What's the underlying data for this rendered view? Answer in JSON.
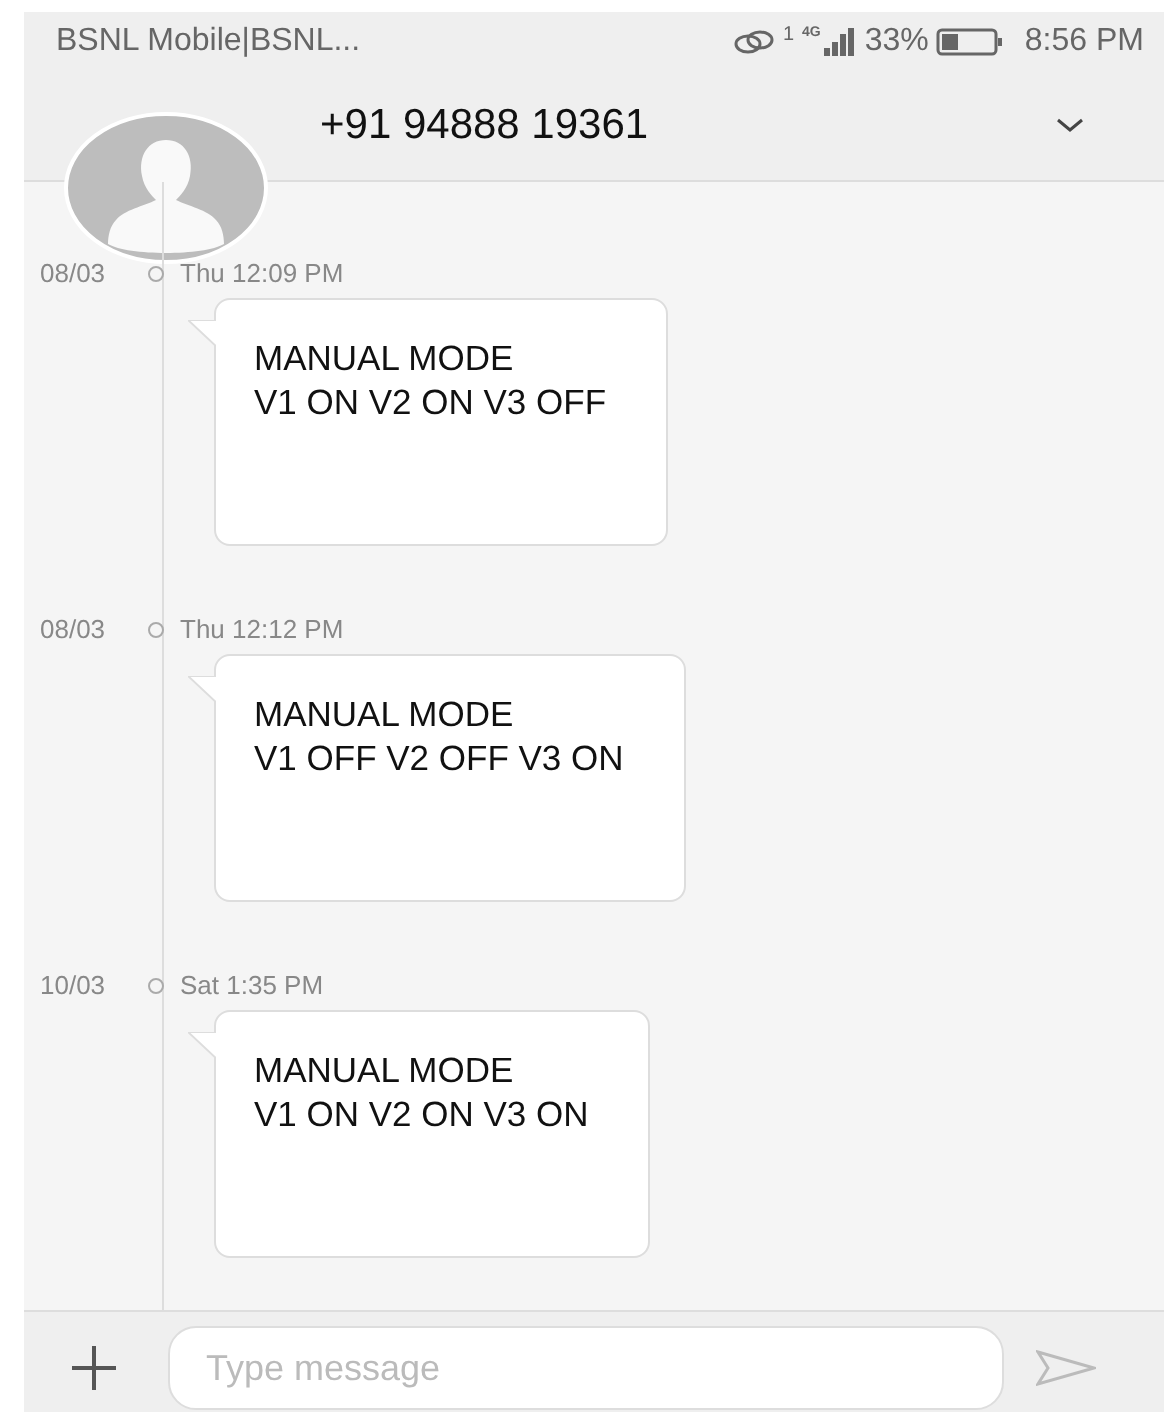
{
  "status_bar": {
    "carrier": "BSNL Mobile|BSNL...",
    "sim_label": "1",
    "network": "4G",
    "battery": "33%",
    "time": "8:56 PM"
  },
  "header": {
    "contact": "+91 94888 19361"
  },
  "messages": [
    {
      "date": "08/03",
      "time": "Thu 12:09 PM",
      "lines": [
        "MANUAL MODE",
        "V1 ON V2 ON V3 OFF"
      ]
    },
    {
      "date": "08/03",
      "time": "Thu 12:12 PM",
      "lines": [
        "MANUAL MODE",
        "V1 OFF V2 OFF V3 ON"
      ]
    },
    {
      "date": "10/03",
      "time": "Sat 1:35 PM",
      "lines": [
        "MANUAL MODE",
        "V1 ON V2 ON V3 ON"
      ]
    }
  ],
  "composer": {
    "placeholder": "Type message"
  }
}
